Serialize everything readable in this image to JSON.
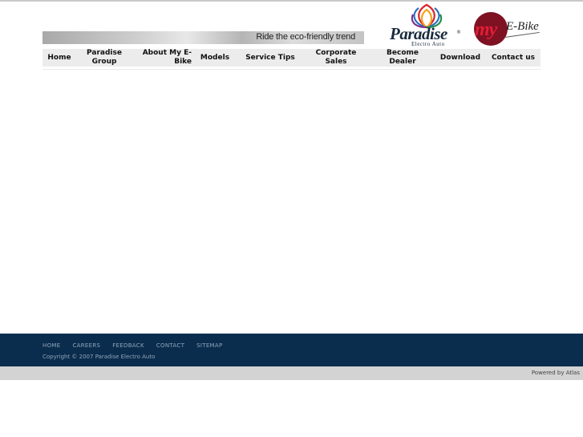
{
  "header": {
    "tagline": "Ride the eco-friendly trend",
    "logo_paradise": {
      "name": "Paradise",
      "registered": "®",
      "subtitle": "Electro Auto",
      "flower_colors": [
        "#d8242c",
        "#2a6fbf",
        "#f2a31a",
        "#7b2f8e",
        "#1f8f4a"
      ]
    },
    "logo_myebike": {
      "my": "my",
      "ebike": "E-Bike",
      "accent": "#e21d35",
      "circle": "#7e1222"
    }
  },
  "nav": {
    "items": [
      {
        "label": "Home"
      },
      {
        "label": "Paradise Group"
      },
      {
        "label": "About My E-Bike"
      },
      {
        "label": "Models"
      },
      {
        "label": "Service Tips"
      },
      {
        "label": "Corporate Sales"
      },
      {
        "label": "Become Dealer"
      },
      {
        "label": "Download"
      },
      {
        "label": "Contact us"
      }
    ]
  },
  "footer": {
    "links": [
      {
        "label": "HOME"
      },
      {
        "label": "CAREERS"
      },
      {
        "label": "FEEDBACK"
      },
      {
        "label": "CONTACT"
      },
      {
        "label": "SITEMAP"
      }
    ],
    "copyright": "Copyright © 2007 Paradise Electro Auto",
    "powered_by": "Powered by Atlas",
    "background": "#0b2d4d"
  }
}
